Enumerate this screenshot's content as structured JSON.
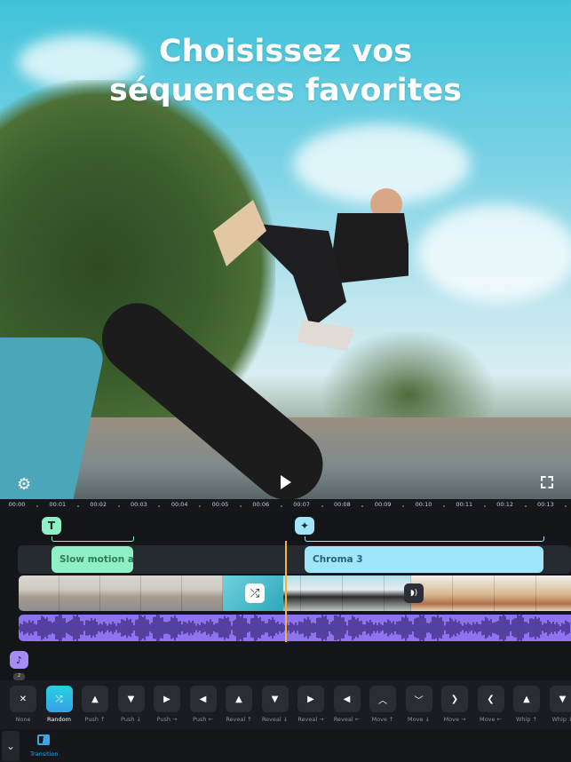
{
  "headline": {
    "line1": "Choisissez vos",
    "line2": "séquences favorites"
  },
  "preview": {
    "play_icon": "play-icon",
    "settings_icon": "gear-icon",
    "fullscreen_icon": "fullscreen-icon"
  },
  "ruler": {
    "ticks": [
      "00:00",
      "00:01",
      "00:02",
      "00:03",
      "00:04",
      "00:05",
      "00:06",
      "00:07",
      "00:08",
      "00:09",
      "00:10",
      "00:11",
      "00:12",
      "00:13"
    ]
  },
  "timeline": {
    "text_marker": "T",
    "text_clip": "Slow motion and",
    "effect_clip": "Chroma 3",
    "music_count": "2",
    "colors": {
      "text_clip": "#8ff0c4",
      "effect_clip": "#a0e6fb",
      "audio": "#8e72ee",
      "playhead": "#f0b43a",
      "accent": "#2ec9e0"
    }
  },
  "transitions": [
    {
      "label": "None",
      "glyph": "✕"
    },
    {
      "label": "Random",
      "glyph": "⤮",
      "selected": true
    },
    {
      "label": "Push ↑",
      "glyph": "▲"
    },
    {
      "label": "Push ↓",
      "glyph": "▼"
    },
    {
      "label": "Push →",
      "glyph": "▶"
    },
    {
      "label": "Push ←",
      "glyph": "◀"
    },
    {
      "label": "Reveal ↑",
      "glyph": "▲"
    },
    {
      "label": "Reveal ↓",
      "glyph": "▼"
    },
    {
      "label": "Reveal →",
      "glyph": "▶"
    },
    {
      "label": "Reveal ←",
      "glyph": "◀"
    },
    {
      "label": "Move ↑",
      "glyph": "︿"
    },
    {
      "label": "Move ↓",
      "glyph": "﹀"
    },
    {
      "label": "Move →",
      "glyph": "❯"
    },
    {
      "label": "Move ←",
      "glyph": "❮"
    },
    {
      "label": "Whip ↑",
      "glyph": "▲"
    },
    {
      "label": "Whip ↓",
      "glyph": "▼"
    }
  ],
  "bottom": {
    "tab_label": "Transition",
    "collapse_glyph": "⌄"
  }
}
